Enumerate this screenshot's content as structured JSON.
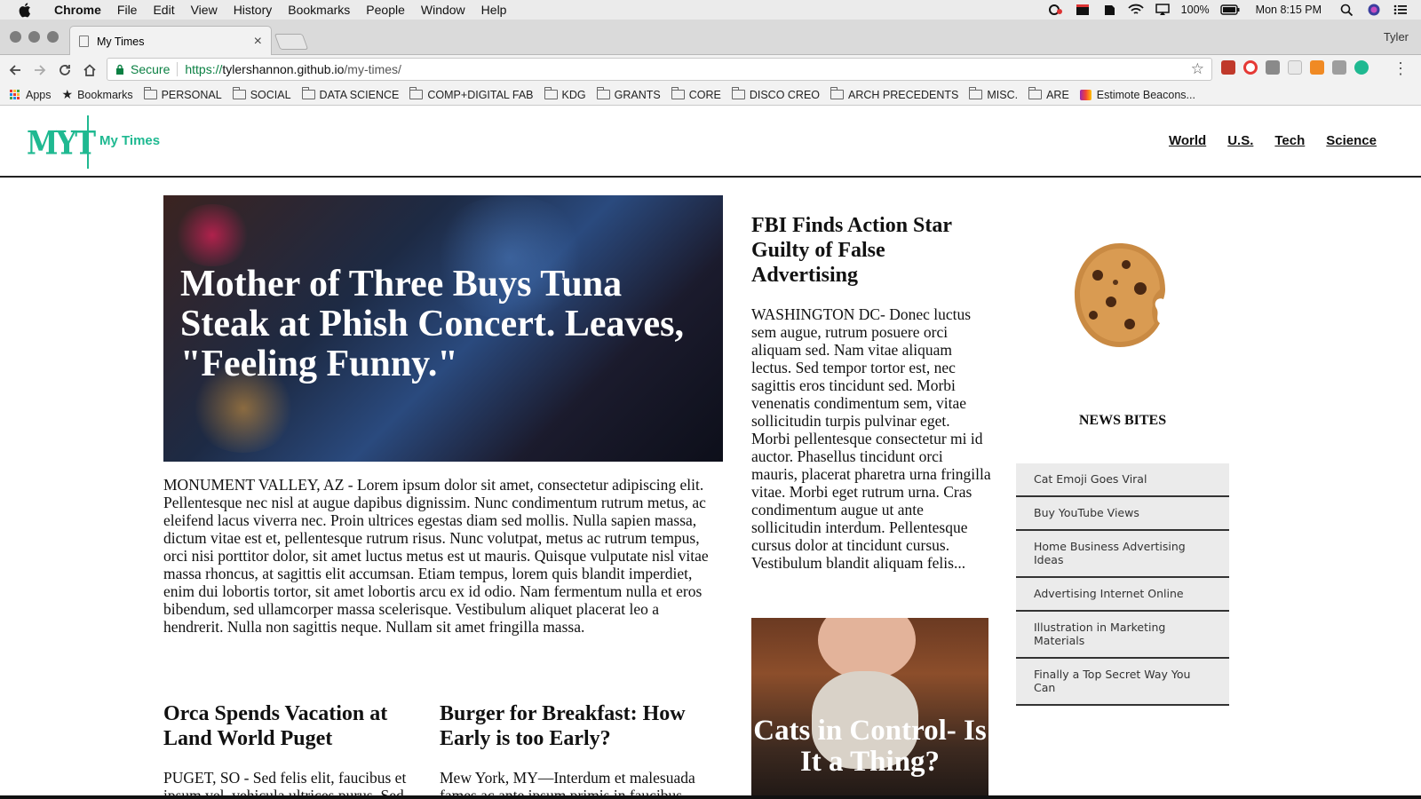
{
  "menubar": {
    "app": "Chrome",
    "items": [
      "File",
      "Edit",
      "View",
      "History",
      "Bookmarks",
      "People",
      "Window",
      "Help"
    ],
    "battery": "100%",
    "clock": "Mon 8:15 PM"
  },
  "browser": {
    "tab_title": "My Times",
    "profile": "Tyler",
    "secure_label": "Secure",
    "url_scheme": "https://",
    "url_host": "tylershannon.github.io",
    "url_path": "/my-times/"
  },
  "bookmarks": {
    "apps": "Apps",
    "bookmarks": "Bookmarks",
    "folders": [
      "PERSONAL",
      "SOCIAL",
      "DATA SCIENCE",
      "COMP+DIGITAL FAB",
      "KDG",
      "GRANTS",
      "CORE",
      "DISCO CREO",
      "ARCH PRECEDENTS",
      "MISC.",
      "ARE"
    ],
    "last": "Estimote Beacons..."
  },
  "site": {
    "logo": "MYT",
    "name": "My Times",
    "nav": [
      "World",
      "U.S.",
      "Tech",
      "Science"
    ]
  },
  "lead": {
    "headline": "Mother of Three Buys Tuna Steak at Phish Concert. Leaves, \"Feeling Funny.\"",
    "body": "MONUMENT VALLEY, AZ - Lorem ipsum dolor sit amet, consectetur adipiscing elit. Pellentesque nec nisl at augue dapibus dignissim. Nunc condimentum rutrum metus, ac eleifend lacus viverra nec. Proin ultrices egestas diam sed mollis. Nulla sapien massa, dictum vitae est et, pellentesque rutrum risus. Nunc volutpat, metus ac rutrum tempus, orci nisi porttitor dolor, sit amet luctus metus est ut mauris. Quisque vulputate nisl vitae massa rhoncus, at sagittis elit accumsan. Etiam tempus, lorem quis blandit imperdiet, enim dui lobortis tortor, sit amet lobortis arcu ex id odio. Nam fermentum nulla et eros bibendum, sed ullamcorper massa scelerisque. Vestibulum aliquet placerat leo a hendrerit. Nulla non sagittis neque. Nullam sit amet fringilla massa."
  },
  "stories": {
    "orca": {
      "headline": "Orca Spends Vacation at Land World Puget",
      "body": "PUGET, SO - Sed felis elit, faucibus et ipsum vel, vehicula ultrices purus. Sed"
    },
    "burger": {
      "headline": "Burger for Breakfast: How Early is too Early?",
      "body": "Mew York, MY—Interdum et malesuada fames ac ante ipsum primis in faucibus."
    },
    "fbi": {
      "headline": "FBI Finds Action Star Guilty of False Advertising",
      "body": "WASHINGTON DC- Donec luctus sem augue, rutrum posuere orci aliquam sed. Nam vitae aliquam lectus. Sed tempor tortor est, nec sagittis eros tincidunt sed. Morbi venenatis condimentum sem, vitae sollicitudin turpis pulvinar eget. Morbi pellentesque consectetur mi id auctor. Phasellus tincidunt orci mauris, placerat pharetra urna fringilla vitae. Morbi eget rutrum urna. Cras condimentum augue ut ante sollicitudin interdum. Pellentesque cursus dolor at tincidunt cursus. Vestibulum blandit aliquam felis..."
    },
    "cats": {
      "headline": "Cats in Control- Is It a Thing?"
    }
  },
  "sidebar": {
    "title": "NEWS BITES",
    "items": [
      "Cat Emoji Goes Viral",
      "Buy YouTube Views",
      "Home Business Advertising Ideas",
      "Advertising Internet Online",
      "Illustration in Marketing Materials",
      "Finally a Top Secret Way You Can"
    ]
  },
  "colors": {
    "brand": "#1fb991",
    "secure": "#0b8043"
  }
}
